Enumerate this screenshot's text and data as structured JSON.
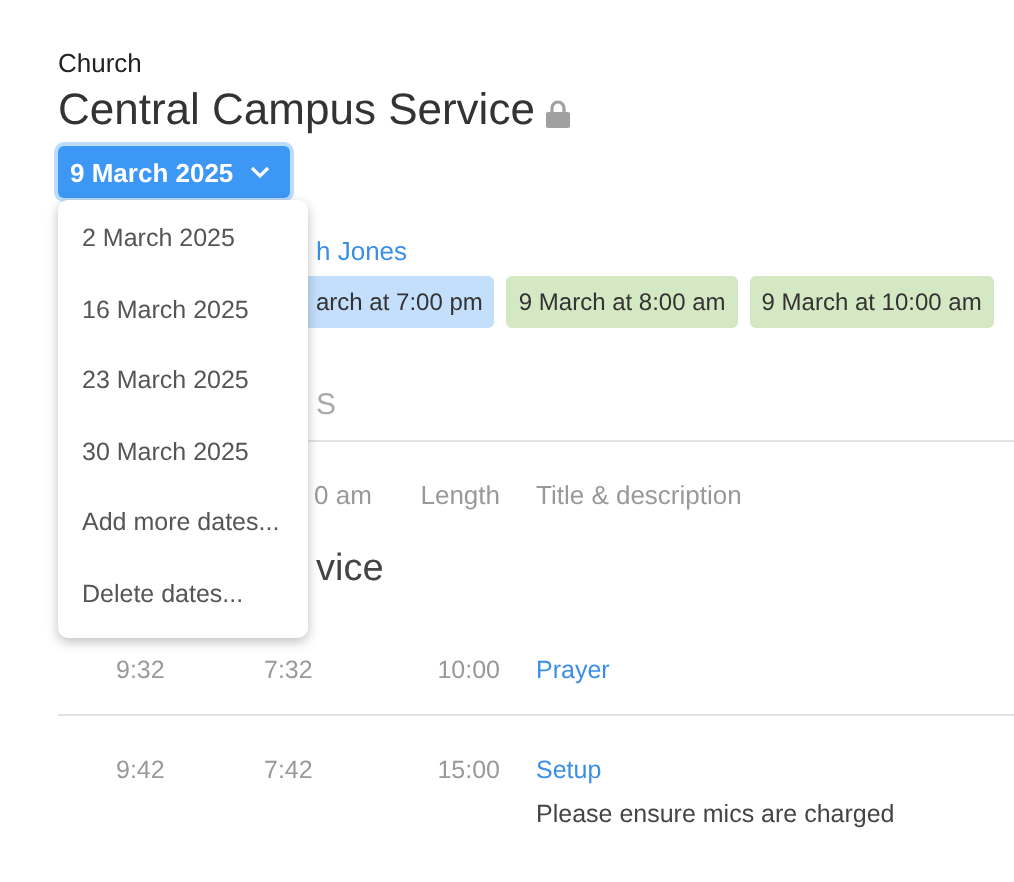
{
  "header": {
    "org": "Church",
    "title": "Central Campus Service",
    "locked": true
  },
  "date_button": {
    "label": "9 March 2025",
    "expanded": true
  },
  "date_menu": {
    "items": [
      "2 March 2025",
      "16 March 2025",
      "23 March 2025",
      "30 March 2025",
      "Add more dates...",
      "Delete dates..."
    ]
  },
  "page": {
    "link": "h Jones",
    "times": [
      {
        "label": "arch at 7:00 pm",
        "selected": true
      },
      {
        "label": "9 March at 8:00 am",
        "selected": false
      },
      {
        "label": "9 March at 10:00 am",
        "selected": false
      }
    ],
    "tab": "S",
    "columns": [
      "0 am",
      "Length",
      "Title & description"
    ],
    "section": "vice",
    "rows": [
      {
        "time_1": "9:32",
        "time_2": "7:32",
        "length": "10:00",
        "title": "Prayer"
      },
      {
        "time_1": "9:42",
        "time_2": "7:42",
        "length": "15:00",
        "title": "Setup",
        "description": "Please ensure mics are charged"
      }
    ]
  }
}
